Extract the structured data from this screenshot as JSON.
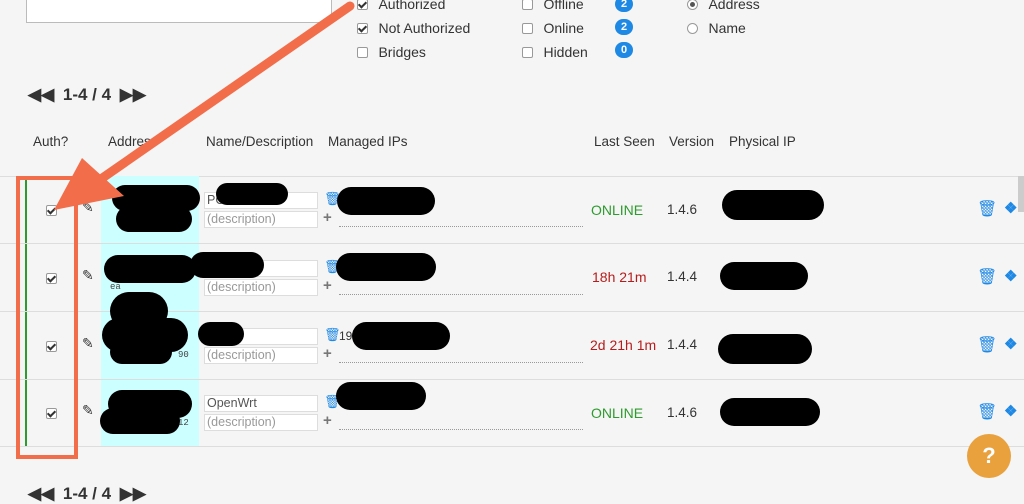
{
  "filters": {
    "auth": [
      {
        "label": "Authorized",
        "checked": true
      },
      {
        "label": "Not Authorized",
        "checked": true
      },
      {
        "label": "Bridges",
        "checked": false
      }
    ],
    "status": [
      {
        "label": "Offline",
        "checked": false,
        "count": "2"
      },
      {
        "label": "Online",
        "checked": false,
        "count": "2"
      },
      {
        "label": "Hidden",
        "checked": false,
        "count": "0"
      }
    ],
    "sort": [
      {
        "label": "Address",
        "selected": true
      },
      {
        "label": "Name",
        "selected": false
      }
    ]
  },
  "pager": {
    "range": "1-4 / 4"
  },
  "columns": {
    "auth": "Auth?",
    "address": "Address",
    "name": "Name/Description",
    "managed_ips": "Managed IPs",
    "last_seen": "Last Seen",
    "version": "Version",
    "physical_ip": "Physical IP"
  },
  "rows": [
    {
      "name": "PC",
      "description": "(description)",
      "ip": "",
      "address_fragment": "",
      "last_seen": "ONLINE",
      "status": "online",
      "version": "1.4.6",
      "checked": true
    },
    {
      "name": "",
      "description": "(description)",
      "ip": "",
      "address_fragment": "ea",
      "last_seen": "18h 21m",
      "status": "offline",
      "version": "1.4.4",
      "checked": true
    },
    {
      "name": "",
      "description": "(description)",
      "ip": "19",
      "address_fragment": "90",
      "last_seen": "2d 21h 1m",
      "status": "offline",
      "version": "1.4.4",
      "checked": true
    },
    {
      "name": "OpenWrt",
      "description": "(description)",
      "ip": "",
      "address_fragment": "12",
      "last_seen": "ONLINE",
      "status": "online",
      "version": "1.4.6",
      "checked": true
    }
  ],
  "help_label": "?",
  "icons": {
    "trash": "trash-icon",
    "eye": "eye-icon",
    "pencil": "pencil-icon",
    "first": "first-page-icon",
    "next": "next-page-icon"
  },
  "colors": {
    "online": "#2e9b2e",
    "offline": "#b71c1c",
    "accent": "#1e88e5",
    "annotation": "#f26d4a",
    "highlight": "#ccffff"
  }
}
